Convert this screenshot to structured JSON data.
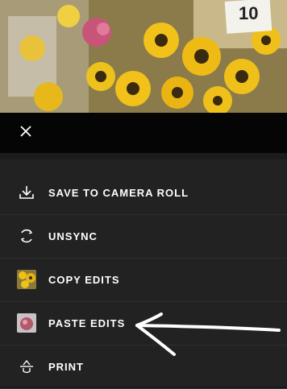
{
  "photo": {
    "price_tag": "10"
  },
  "header": {
    "close_icon": "close-icon"
  },
  "menu": {
    "items": [
      {
        "label": "SAVE TO CAMERA ROLL",
        "icon": "download-icon"
      },
      {
        "label": "UNSYNC",
        "icon": "sync-icon"
      },
      {
        "label": "COPY EDITS",
        "icon": "copy-thumbnail-icon"
      },
      {
        "label": "PASTE EDITS",
        "icon": "paste-thumbnail-icon"
      },
      {
        "label": "PRINT",
        "icon": "print-icon"
      }
    ]
  },
  "colors": {
    "background": "#222222",
    "topbar": "#050505",
    "text": "#ffffff"
  }
}
